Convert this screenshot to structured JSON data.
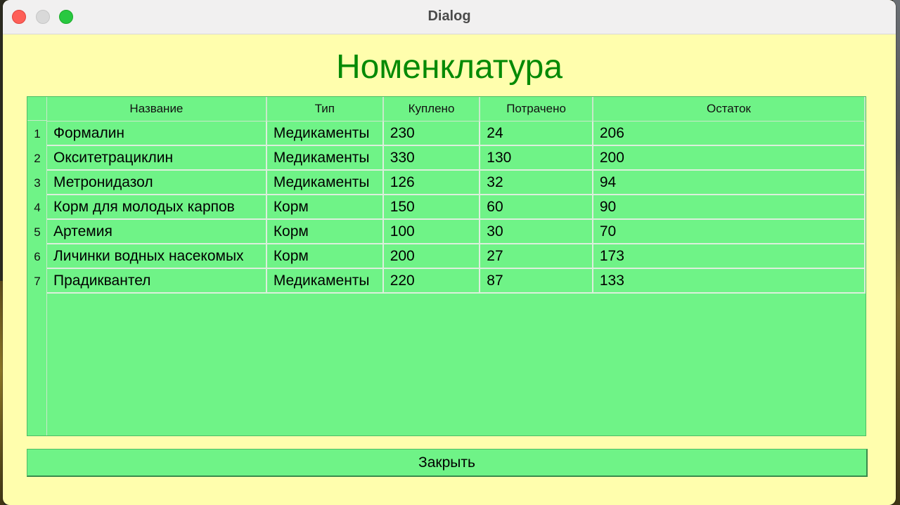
{
  "window": {
    "title": "Dialog"
  },
  "heading": "Номенклатура",
  "table": {
    "columns": [
      "Название",
      "Тип",
      "Куплено",
      "Потрачено",
      "Остаток"
    ],
    "rows": [
      {
        "num": "1",
        "cells": [
          "Формалин",
          "Медикаменты",
          "230",
          "24",
          "206"
        ]
      },
      {
        "num": "2",
        "cells": [
          "Окситетрациклин",
          "Медикаменты",
          "330",
          "130",
          "200"
        ]
      },
      {
        "num": "3",
        "cells": [
          "Метронидазол",
          "Медикаменты",
          "126",
          "32",
          "94"
        ]
      },
      {
        "num": "4",
        "cells": [
          "Корм для молодых карпов",
          "Корм",
          "150",
          "60",
          "90"
        ]
      },
      {
        "num": "5",
        "cells": [
          "Артемия",
          "Корм",
          "100",
          "30",
          "70"
        ]
      },
      {
        "num": "6",
        "cells": [
          "Личинки водных насекомых",
          "Корм",
          "200",
          "27",
          "173"
        ]
      },
      {
        "num": "7",
        "cells": [
          "Прадиквантел",
          "Медикаменты",
          "220",
          "87",
          "133"
        ]
      }
    ]
  },
  "close_button": {
    "label": "Закрыть"
  },
  "colors": {
    "window_bg": "#fffead",
    "table_bg": "#6ff387",
    "heading": "#068a06"
  }
}
